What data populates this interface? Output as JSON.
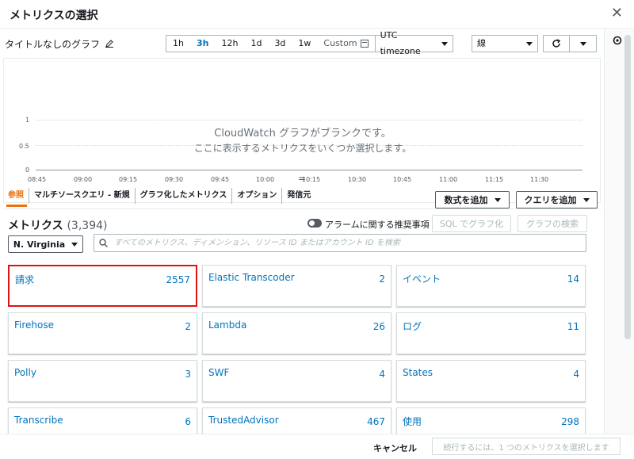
{
  "dialog": {
    "title": "メトリクスの選択",
    "close_glyph": "✕"
  },
  "graph_header": {
    "title": "タイトルなしのグラフ",
    "time_ranges": [
      "1h",
      "3h",
      "12h",
      "1d",
      "3d",
      "1w"
    ],
    "active_range": "3h",
    "custom_label": "Custom",
    "timezone": "UTC timezone",
    "line_type": "線"
  },
  "graph": {
    "y_ticks": [
      "1",
      "0.5",
      "0"
    ],
    "x_ticks": [
      "08:45",
      "09:00",
      "09:15",
      "09:30",
      "09:45",
      "10:00",
      "10:15",
      "10:30",
      "10:45",
      "11:00",
      "11:15",
      "11:30"
    ],
    "blank_line1": "CloudWatch グラフがブランクです。",
    "blank_line2": "ここに表示するメトリクスをいくつか選択します。",
    "splitter_glyph": "="
  },
  "tabs": [
    {
      "label": "参照",
      "active": true
    },
    {
      "label": "マルチソースクエリ - 新規",
      "active": false
    },
    {
      "label": "グラフ化したメトリクス",
      "active": false
    },
    {
      "label": "オプション",
      "active": false
    },
    {
      "label": "発信元",
      "active": false
    }
  ],
  "actions": {
    "add_math": "数式を追加",
    "add_query": "クエリを追加"
  },
  "metrics": {
    "title": "メトリクス",
    "count": "(3,394)",
    "alarm_toggle_label": "アラームに関する推奨事項",
    "sql_graph_button": "SQL でグラフ化",
    "graph_search_button": "グラフの検索",
    "region": "N. Virginia",
    "search_placeholder": "すべてのメトリクス、ディメンション、リソース ID またはアカウント ID を検索"
  },
  "namespaces": [
    {
      "name": "請求",
      "count": "2557",
      "selected": true
    },
    {
      "name": "Elastic Transcoder",
      "count": "2",
      "selected": false
    },
    {
      "name": "イベント",
      "count": "14",
      "selected": false
    },
    {
      "name": "Firehose",
      "count": "2",
      "selected": false
    },
    {
      "name": "Lambda",
      "count": "26",
      "selected": false
    },
    {
      "name": "ログ",
      "count": "11",
      "selected": false
    },
    {
      "name": "Polly",
      "count": "3",
      "selected": false
    },
    {
      "name": "SWF",
      "count": "4",
      "selected": false
    },
    {
      "name": "States",
      "count": "4",
      "selected": false
    },
    {
      "name": "Transcribe",
      "count": "6",
      "selected": false
    },
    {
      "name": "TrustedAdvisor",
      "count": "467",
      "selected": false
    },
    {
      "name": "使用",
      "count": "298",
      "selected": false
    }
  ],
  "footer": {
    "cancel": "キャンセル",
    "continue": "続行するには、1 つのメトリクスを選択します"
  },
  "colors": {
    "accent": "#ec7211",
    "link": "#0073bb",
    "selection_highlight": "#d91515"
  }
}
